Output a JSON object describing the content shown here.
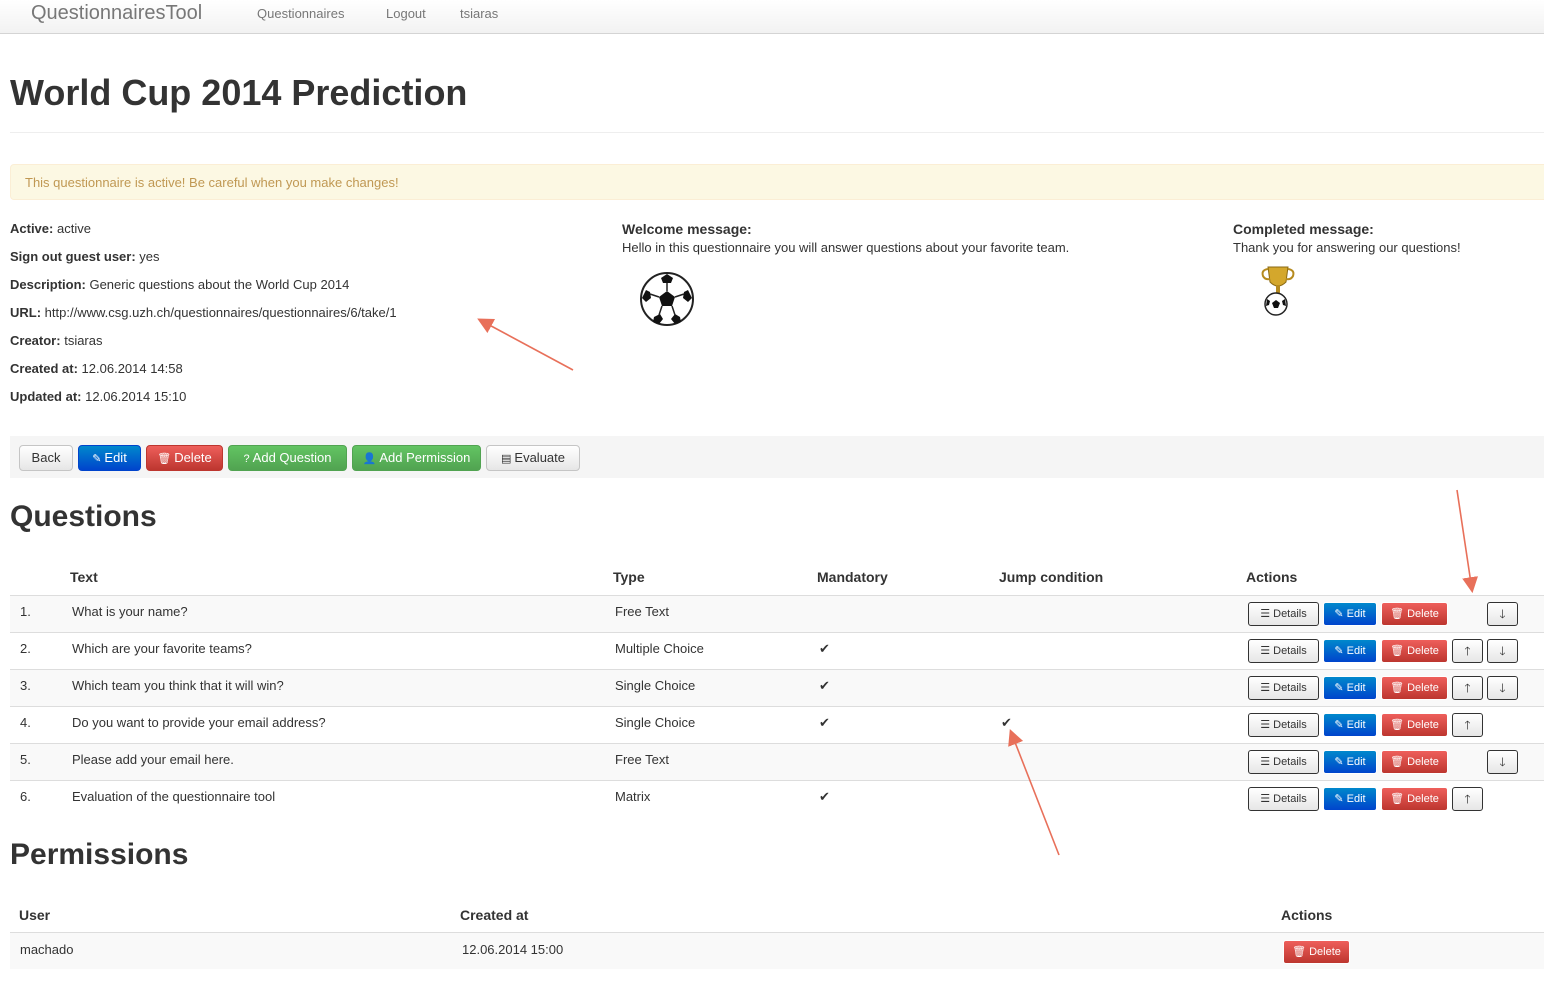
{
  "nav": {
    "brand": "QuestionnairesTool",
    "links": [
      "Questionnaires",
      "Logout",
      "tsiaras"
    ]
  },
  "page": {
    "title": "World Cup 2014 Prediction",
    "alert": "This questionnaire is active! Be careful when you make changes!"
  },
  "details": {
    "active": {
      "label": "Active:",
      "value": "active"
    },
    "signout": {
      "label": "Sign out guest user:",
      "value": "yes"
    },
    "description": {
      "label": "Description:",
      "value": "Generic questions about the World Cup 2014"
    },
    "url": {
      "label": "URL:",
      "value": "http://www.csg.uzh.ch/questionnaires/questionnaires/6/take/1"
    },
    "creator": {
      "label": "Creator:",
      "value": "tsiaras"
    },
    "created": {
      "label": "Created at:",
      "value": "12.06.2014 14:58"
    },
    "updated": {
      "label": "Updated at:",
      "value": "12.06.2014 15:10"
    }
  },
  "welcome": {
    "label": "Welcome message:",
    "text": "Hello in this questionnaire you will answer questions about your favorite team.",
    "image": "soccer-ball-icon"
  },
  "completed": {
    "label": "Completed message:",
    "text": "Thank you for answering our questions!",
    "image": "trophy-icon"
  },
  "toolbar": {
    "back": "Back",
    "edit": "Edit",
    "delete": "Delete",
    "add_question": "Add Question",
    "add_permission": "Add Permission",
    "evaluate": "Evaluate"
  },
  "questions": {
    "title": "Questions",
    "headers": {
      "text": "Text",
      "type": "Type",
      "mandatory": "Mandatory",
      "jump": "Jump condition",
      "actions": "Actions"
    },
    "buttons": {
      "details": "Details",
      "edit": "Edit",
      "delete": "Delete"
    },
    "rows": [
      {
        "num": "1.",
        "text": "What is your name?",
        "type": "Free Text",
        "mandatory": false,
        "jump": false,
        "up": false,
        "down": true
      },
      {
        "num": "2.",
        "text": "Which are your favorite teams?",
        "type": "Multiple Choice",
        "mandatory": true,
        "jump": false,
        "up": true,
        "down": true
      },
      {
        "num": "3.",
        "text": "Which team you think that it will win?",
        "type": "Single Choice",
        "mandatory": true,
        "jump": false,
        "up": true,
        "down": true
      },
      {
        "num": "4.",
        "text": "Do you want to provide your email address?",
        "type": "Single Choice",
        "mandatory": true,
        "jump": true,
        "up": true,
        "down": false
      },
      {
        "num": "5.",
        "text": "Please add your email here.",
        "type": "Free Text",
        "mandatory": false,
        "jump": false,
        "up": false,
        "down": true
      },
      {
        "num": "6.",
        "text": "Evaluation of the questionnaire tool",
        "type": "Matrix",
        "mandatory": true,
        "jump": false,
        "up": true,
        "down": false
      }
    ]
  },
  "permissions": {
    "title": "Permissions",
    "headers": {
      "user": "User",
      "created": "Created at",
      "actions": "Actions"
    },
    "delete": "Delete",
    "rows": [
      {
        "user": "machado",
        "created": "12.06.2014 15:00"
      }
    ]
  },
  "colors": {
    "primary": "#0055cc",
    "danger": "#da4f49",
    "success": "#5bb75b",
    "alert_bg": "#fcf8e3",
    "alert_text": "#c09853",
    "annotation_arrow": "#e8705a"
  }
}
